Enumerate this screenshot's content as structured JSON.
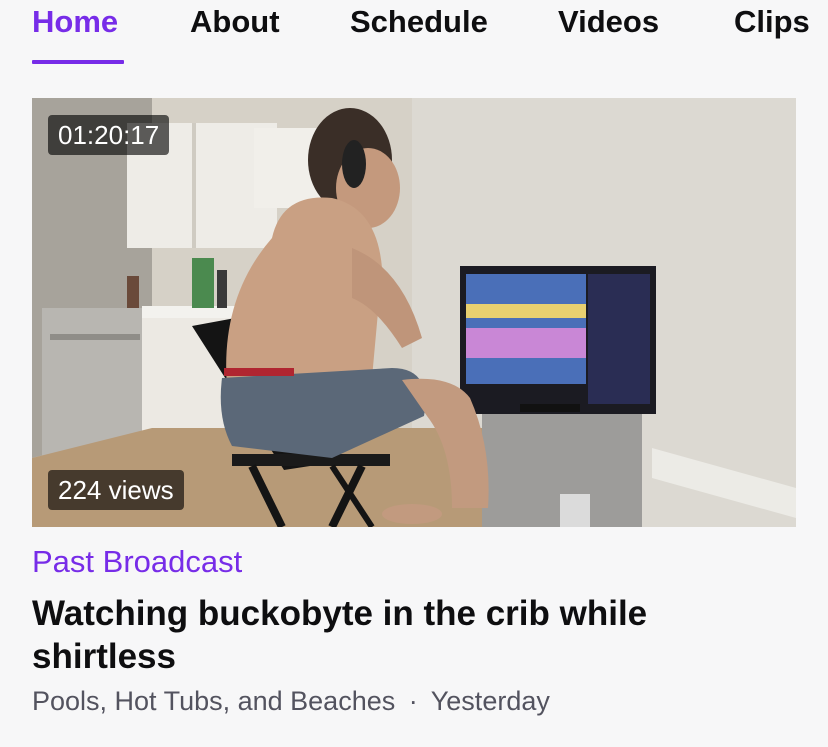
{
  "tabs": [
    {
      "label": "Home",
      "active": true
    },
    {
      "label": "About",
      "active": false
    },
    {
      "label": "Schedule",
      "active": false
    },
    {
      "label": "Videos",
      "active": false
    },
    {
      "label": "Clips",
      "active": false
    }
  ],
  "video": {
    "duration": "01:20:17",
    "views": "224 views",
    "type_label": "Past Broadcast",
    "title": "Watching buckobyte in the crib while shirtless",
    "category": "Pools, Hot Tubs, and Beaches",
    "separator": "·",
    "date": "Yesterday"
  },
  "colors": {
    "accent": "#772ce8",
    "text": "#0e0e10",
    "muted": "#53535f",
    "background": "#f7f7f8"
  }
}
